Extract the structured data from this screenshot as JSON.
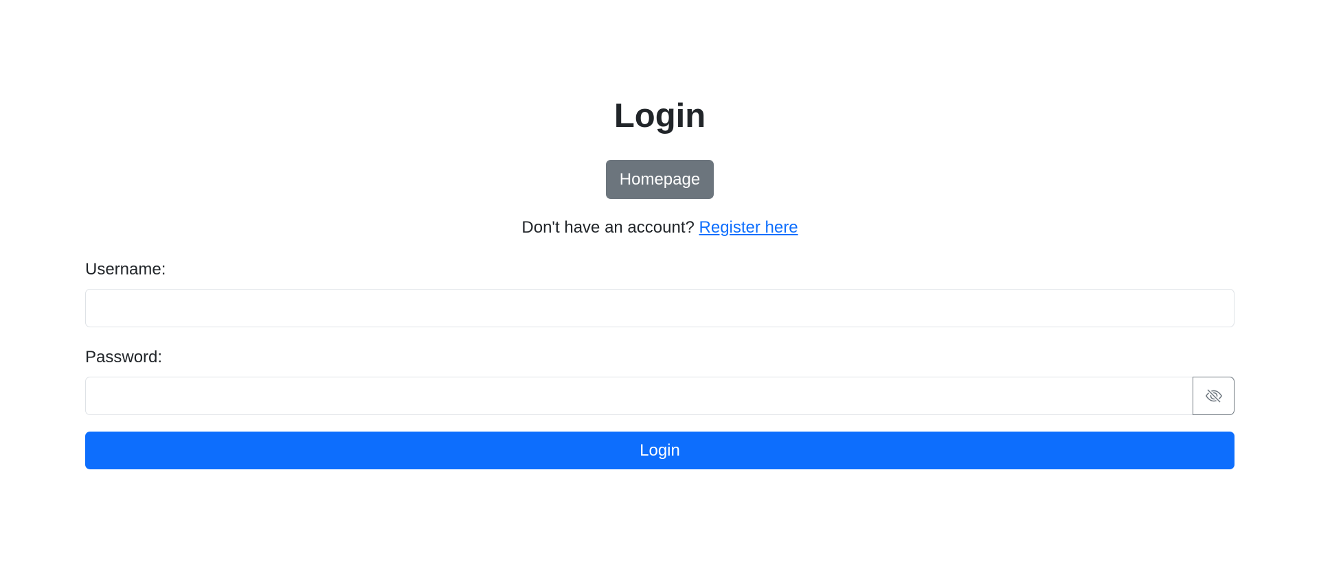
{
  "page": {
    "title": "Login"
  },
  "homepage_button": {
    "label": "Homepage"
  },
  "register": {
    "prompt": "Don't have an account?",
    "link_text": "Register here"
  },
  "form": {
    "username_label": "Username:",
    "username_value": "",
    "password_label": "Password:",
    "password_value": "",
    "toggle_icon": "eye-slash-icon",
    "submit_label": "Login"
  },
  "colors": {
    "primary": "#0d6efd",
    "secondary": "#6c757d",
    "text": "#212529",
    "link": "#0d6efd"
  }
}
